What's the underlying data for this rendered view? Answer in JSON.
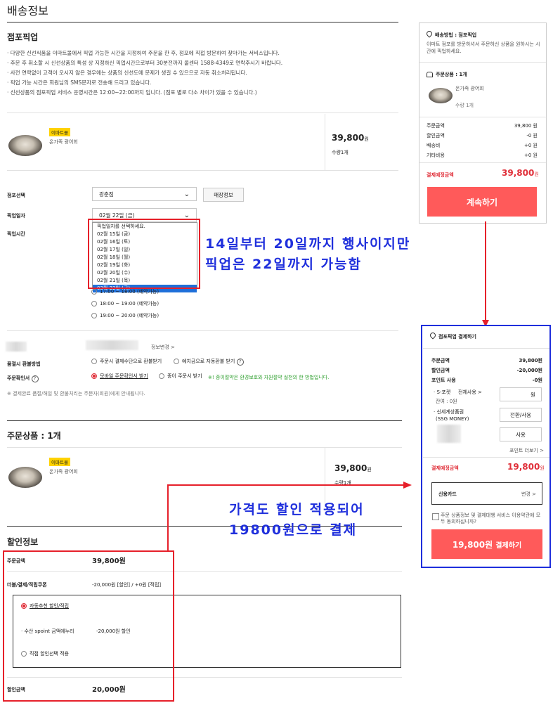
{
  "page_title": "배송정보",
  "pickup": {
    "section_title": "점포픽업",
    "notices": [
      "· 다양한 신선식품을 이마트몰에서 픽업 가능한 시간을 지정하여 주문을 한 후, 점포에 직접 방문하여 찾아가는 서비스입니다.",
      "· 주문 후 취소할 시 신선상품의 특성 상 지정하신 픽업시간으로부터 30분전까지 콜센터 1588-4349로 연락주시기 바랍니다.",
      "· 사전 연락없이 고객이 오시지 않은 경우에는 상품의 신선도에 문제가 생길 수 있으므로 자동 취소처리됩니다.",
      "· 픽업 가능 시간은 회원님의 SMS문자로 전송해 드리고 있습니다.",
      "· 신선상품의 점포픽업 서비스 운영시간은 12:00~22:00까지 입니다. (점포 별로 다소 차이가 있을 수 있습니다.)"
    ],
    "product": {
      "badge": "이마트몰",
      "name": "온가족 광어회",
      "price": "39,800",
      "won": "원",
      "qty": "수량1개"
    },
    "store_label": "점포선택",
    "store_value": "광춘점",
    "store_info_btn": "매장정보",
    "date_label": "픽업일자",
    "date_value": "02월 22일 (금)",
    "time_label": "픽업시간",
    "date_options": [
      "픽업일자를 선택하세요.",
      "02월 15일 (금)",
      "02월 16일 (토)",
      "02월 17일 (일)",
      "02월 18일 (월)",
      "02월 19일 (화)",
      "02월 20일 (수)",
      "02월 21일 (목)",
      "02월 22일 (금)"
    ],
    "time_options": [
      "17:00 ~ 18:00 (예약가능)",
      "18:00 ~ 19:00 (예약가능)",
      "19:00 ~ 20:00 (예약가능)"
    ],
    "info_change": "정보변경 >",
    "refund_label": "품절시 환불방법",
    "refund_opt1": "주문시 결제수단으로 환불받기",
    "refund_opt2": "예치금으로 자동환불 받기",
    "receipt_label": "주문확인서",
    "receipt_opt1": "모바일 주문확인서 받기",
    "receipt_opt2": "종이 주문서 받기",
    "receipt_note": "※! 종이절약은 환경보호와 자원절약 실천의 한 방법입니다.",
    "footnote": "※ 결제완료 품절/해일 및 환불처리는 주문자(회원)에게 안내됩니다."
  },
  "order_items": {
    "title": "주문상품 : 1개",
    "product": {
      "badge": "이마트몰",
      "name": "온가족 광어회",
      "price": "39,800",
      "won": "원",
      "qty": "수량1개"
    }
  },
  "discount": {
    "title": "할인정보",
    "order_amount_label": "주문금액",
    "order_amount": "39,800원",
    "coupon_label": "더블/결제/적립쿠폰",
    "coupon_value": "-20,000원 [할인] / +0원 [적립]",
    "auto_option": "자동추천 할인/적립",
    "spoint_label": "· 수산 spoint 금액에누리",
    "spoint_value": "-20,000원 할인",
    "manual_option": "직접 할인선택 적용",
    "discount_amount_label": "할인금액",
    "discount_amount": "20,000원"
  },
  "sidebar": {
    "method_title": "배송방법 : 점포픽업",
    "method_desc": "이마트 점포를 방문하셔서 주문하신 상품을 원하시는 시간에 픽업하세요.",
    "items_title": "주문상품 : 1개",
    "item_name": "온가족 광어회",
    "item_qty": "수량 1개",
    "rows": [
      {
        "label": "주문금액",
        "value": "39,800 원"
      },
      {
        "label": "할인금액",
        "value": "-0 원"
      },
      {
        "label": "배송비",
        "value": "+0 원"
      },
      {
        "label": "기타비용",
        "value": "+0 원"
      }
    ],
    "total_label": "결제예정금액",
    "total_value": "39,800",
    "total_won": "원",
    "continue_btn": "계속하기"
  },
  "payment_panel": {
    "title": "점포픽업 결제하기",
    "rows": [
      {
        "label": "주문금액",
        "value": "39,800원"
      },
      {
        "label": "할인금액",
        "value": "-20,000원"
      },
      {
        "label": "포인트 사용",
        "value": "-0원"
      }
    ],
    "spoint_label": "· S-포켓",
    "spoint_all": "전체사용 >",
    "spoint_balance": "잔여 : 0원",
    "spoint_unit": "원",
    "ssg_label": "· 신세계상품권",
    "ssg_sub": "(SSG MONEY)",
    "convert_btn": "전환/사용",
    "use_btn": "사용",
    "more_points": "포인트 더보기 >",
    "total_label": "결제예정금액",
    "total_value": "19,800",
    "total_won": "원",
    "card_label": "신용카드",
    "card_change": "변경 >",
    "agree_text": "주문 상품정보 및 결제대행 서비스 이용약관에 모두 동의하십니까?",
    "pay_amount": "19,800원",
    "pay_label": "결제하기"
  },
  "annotations": {
    "note1_line1": "14일부터 20일까지 행사이지만",
    "note1_line2": "픽업은 22일까지 가능함",
    "note2_line1": "가격도 할인 적용되어",
    "note2_line2": "19800원으로 결제"
  },
  "colors": {
    "accent_red": "#ff5a5a",
    "annotation_red": "#e6202a",
    "annotation_blue": "#1f2fdc",
    "badge_yellow": "#ffd200"
  }
}
